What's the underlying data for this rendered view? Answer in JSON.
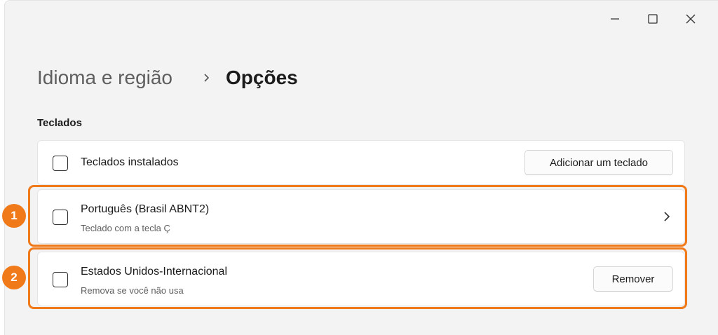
{
  "window": {
    "controls": [
      "minimize-icon",
      "maximize-icon",
      "close-icon"
    ]
  },
  "breadcrumb": {
    "parent": "Idioma e região",
    "separator_icon": "chevron-right-icon",
    "current": "Opções"
  },
  "section": {
    "label": "Teclados"
  },
  "installed": {
    "icon": "keyboard-icon",
    "title": "Teclados instalados",
    "add_button": "Adicionar um teclado"
  },
  "keyboards": [
    {
      "icon": "keyboard-icon",
      "title": "Português (Brasil ABNT2)",
      "subtitle": "Teclado com a tecla Ç",
      "action_icon": "chevron-right-icon"
    },
    {
      "icon": "keyboard-icon",
      "title": "Estados Unidos-Internacional",
      "subtitle": "Remova se você não usa",
      "button": "Remover"
    }
  ],
  "annotations": {
    "badge_1": "1",
    "badge_2": "2",
    "color": "#f07a1a"
  },
  "colors": {
    "background": "#f3f3f3",
    "card": "#ffffff",
    "accent_annotation": "#f07a1a"
  }
}
